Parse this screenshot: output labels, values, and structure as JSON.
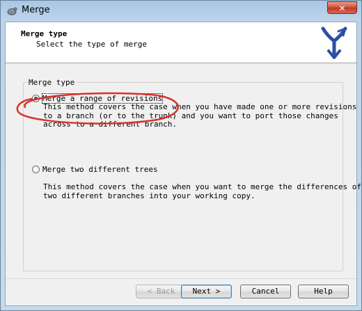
{
  "window": {
    "title": "Merge",
    "close_label": "✕"
  },
  "header": {
    "title": "Merge type",
    "subtitle": "Select the type of merge"
  },
  "group": {
    "legend": "Merge type"
  },
  "options": [
    {
      "label": "Merge a range of revisions",
      "selected": true,
      "description": "This method covers the case when you have made one or more revisions\nto a branch (or to the trunk) and you want to port those changes\nacross to a different branch."
    },
    {
      "label": "Merge two different trees",
      "selected": false,
      "description": "This method covers the case when you want to merge the differences of\ntwo different branches into your working copy."
    }
  ],
  "buttons": {
    "back": "< Back",
    "next": "Next >",
    "cancel": "Cancel",
    "help": "Help"
  },
  "colors": {
    "annotation": "#d9302a",
    "logo": "#2d4fa3"
  },
  "icons": {
    "title": "tortoisesvn-icon",
    "logo": "merge-branch-logo-icon"
  }
}
